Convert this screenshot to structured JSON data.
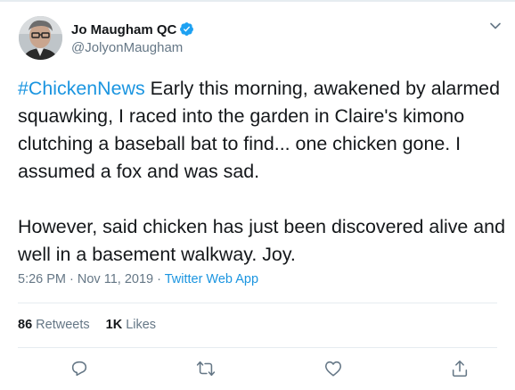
{
  "author": {
    "name": "Jo Maugham QC",
    "handle": "@JolyonMaugham",
    "verified": true
  },
  "tweet": {
    "hashtag": "#ChickenNews",
    "text_part1": " Early this morning, awakened by alarmed squawking, I raced into the garden in Claire's kimono clutching a baseball bat to find... one chicken gone. I assumed a fox and was sad.",
    "text_part2": "However, said chicken has just been discovered alive and well in a basement walkway. Joy."
  },
  "meta": {
    "time": "5:26 PM",
    "separator1": " · ",
    "date": "Nov 11, 2019",
    "separator2": " · ",
    "source": "Twitter Web App"
  },
  "stats": {
    "retweets_count": "86",
    "retweets_label": "Retweets",
    "likes_count": "1K",
    "likes_label": "Likes"
  },
  "icons": {
    "reply": "reply-icon",
    "retweet": "retweet-icon",
    "like": "heart-icon",
    "share": "share-icon",
    "more": "chevron-down-icon",
    "verified": "verified-badge-icon"
  },
  "colors": {
    "link": "#1b95e0",
    "muted": "#657786",
    "text": "#14171a",
    "verified": "#1da1f2"
  }
}
